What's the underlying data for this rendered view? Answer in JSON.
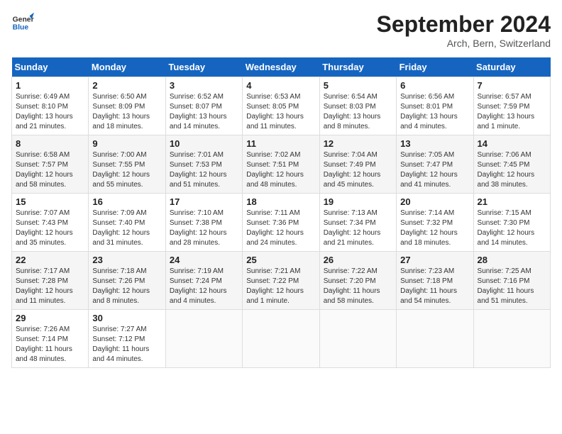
{
  "header": {
    "logo_line1": "General",
    "logo_line2": "Blue",
    "month_title": "September 2024",
    "subtitle": "Arch, Bern, Switzerland"
  },
  "days_of_week": [
    "Sunday",
    "Monday",
    "Tuesday",
    "Wednesday",
    "Thursday",
    "Friday",
    "Saturday"
  ],
  "weeks": [
    [
      {
        "day": "1",
        "info": "Sunrise: 6:49 AM\nSunset: 8:10 PM\nDaylight: 13 hours\nand 21 minutes."
      },
      {
        "day": "2",
        "info": "Sunrise: 6:50 AM\nSunset: 8:09 PM\nDaylight: 13 hours\nand 18 minutes."
      },
      {
        "day": "3",
        "info": "Sunrise: 6:52 AM\nSunset: 8:07 PM\nDaylight: 13 hours\nand 14 minutes."
      },
      {
        "day": "4",
        "info": "Sunrise: 6:53 AM\nSunset: 8:05 PM\nDaylight: 13 hours\nand 11 minutes."
      },
      {
        "day": "5",
        "info": "Sunrise: 6:54 AM\nSunset: 8:03 PM\nDaylight: 13 hours\nand 8 minutes."
      },
      {
        "day": "6",
        "info": "Sunrise: 6:56 AM\nSunset: 8:01 PM\nDaylight: 13 hours\nand 4 minutes."
      },
      {
        "day": "7",
        "info": "Sunrise: 6:57 AM\nSunset: 7:59 PM\nDaylight: 13 hours\nand 1 minute."
      }
    ],
    [
      {
        "day": "8",
        "info": "Sunrise: 6:58 AM\nSunset: 7:57 PM\nDaylight: 12 hours\nand 58 minutes."
      },
      {
        "day": "9",
        "info": "Sunrise: 7:00 AM\nSunset: 7:55 PM\nDaylight: 12 hours\nand 55 minutes."
      },
      {
        "day": "10",
        "info": "Sunrise: 7:01 AM\nSunset: 7:53 PM\nDaylight: 12 hours\nand 51 minutes."
      },
      {
        "day": "11",
        "info": "Sunrise: 7:02 AM\nSunset: 7:51 PM\nDaylight: 12 hours\nand 48 minutes."
      },
      {
        "day": "12",
        "info": "Sunrise: 7:04 AM\nSunset: 7:49 PM\nDaylight: 12 hours\nand 45 minutes."
      },
      {
        "day": "13",
        "info": "Sunrise: 7:05 AM\nSunset: 7:47 PM\nDaylight: 12 hours\nand 41 minutes."
      },
      {
        "day": "14",
        "info": "Sunrise: 7:06 AM\nSunset: 7:45 PM\nDaylight: 12 hours\nand 38 minutes."
      }
    ],
    [
      {
        "day": "15",
        "info": "Sunrise: 7:07 AM\nSunset: 7:43 PM\nDaylight: 12 hours\nand 35 minutes."
      },
      {
        "day": "16",
        "info": "Sunrise: 7:09 AM\nSunset: 7:40 PM\nDaylight: 12 hours\nand 31 minutes."
      },
      {
        "day": "17",
        "info": "Sunrise: 7:10 AM\nSunset: 7:38 PM\nDaylight: 12 hours\nand 28 minutes."
      },
      {
        "day": "18",
        "info": "Sunrise: 7:11 AM\nSunset: 7:36 PM\nDaylight: 12 hours\nand 24 minutes."
      },
      {
        "day": "19",
        "info": "Sunrise: 7:13 AM\nSunset: 7:34 PM\nDaylight: 12 hours\nand 21 minutes."
      },
      {
        "day": "20",
        "info": "Sunrise: 7:14 AM\nSunset: 7:32 PM\nDaylight: 12 hours\nand 18 minutes."
      },
      {
        "day": "21",
        "info": "Sunrise: 7:15 AM\nSunset: 7:30 PM\nDaylight: 12 hours\nand 14 minutes."
      }
    ],
    [
      {
        "day": "22",
        "info": "Sunrise: 7:17 AM\nSunset: 7:28 PM\nDaylight: 12 hours\nand 11 minutes."
      },
      {
        "day": "23",
        "info": "Sunrise: 7:18 AM\nSunset: 7:26 PM\nDaylight: 12 hours\nand 8 minutes."
      },
      {
        "day": "24",
        "info": "Sunrise: 7:19 AM\nSunset: 7:24 PM\nDaylight: 12 hours\nand 4 minutes."
      },
      {
        "day": "25",
        "info": "Sunrise: 7:21 AM\nSunset: 7:22 PM\nDaylight: 12 hours\nand 1 minute."
      },
      {
        "day": "26",
        "info": "Sunrise: 7:22 AM\nSunset: 7:20 PM\nDaylight: 11 hours\nand 58 minutes."
      },
      {
        "day": "27",
        "info": "Sunrise: 7:23 AM\nSunset: 7:18 PM\nDaylight: 11 hours\nand 54 minutes."
      },
      {
        "day": "28",
        "info": "Sunrise: 7:25 AM\nSunset: 7:16 PM\nDaylight: 11 hours\nand 51 minutes."
      }
    ],
    [
      {
        "day": "29",
        "info": "Sunrise: 7:26 AM\nSunset: 7:14 PM\nDaylight: 11 hours\nand 48 minutes."
      },
      {
        "day": "30",
        "info": "Sunrise: 7:27 AM\nSunset: 7:12 PM\nDaylight: 11 hours\nand 44 minutes."
      },
      {
        "day": "",
        "info": ""
      },
      {
        "day": "",
        "info": ""
      },
      {
        "day": "",
        "info": ""
      },
      {
        "day": "",
        "info": ""
      },
      {
        "day": "",
        "info": ""
      }
    ]
  ]
}
